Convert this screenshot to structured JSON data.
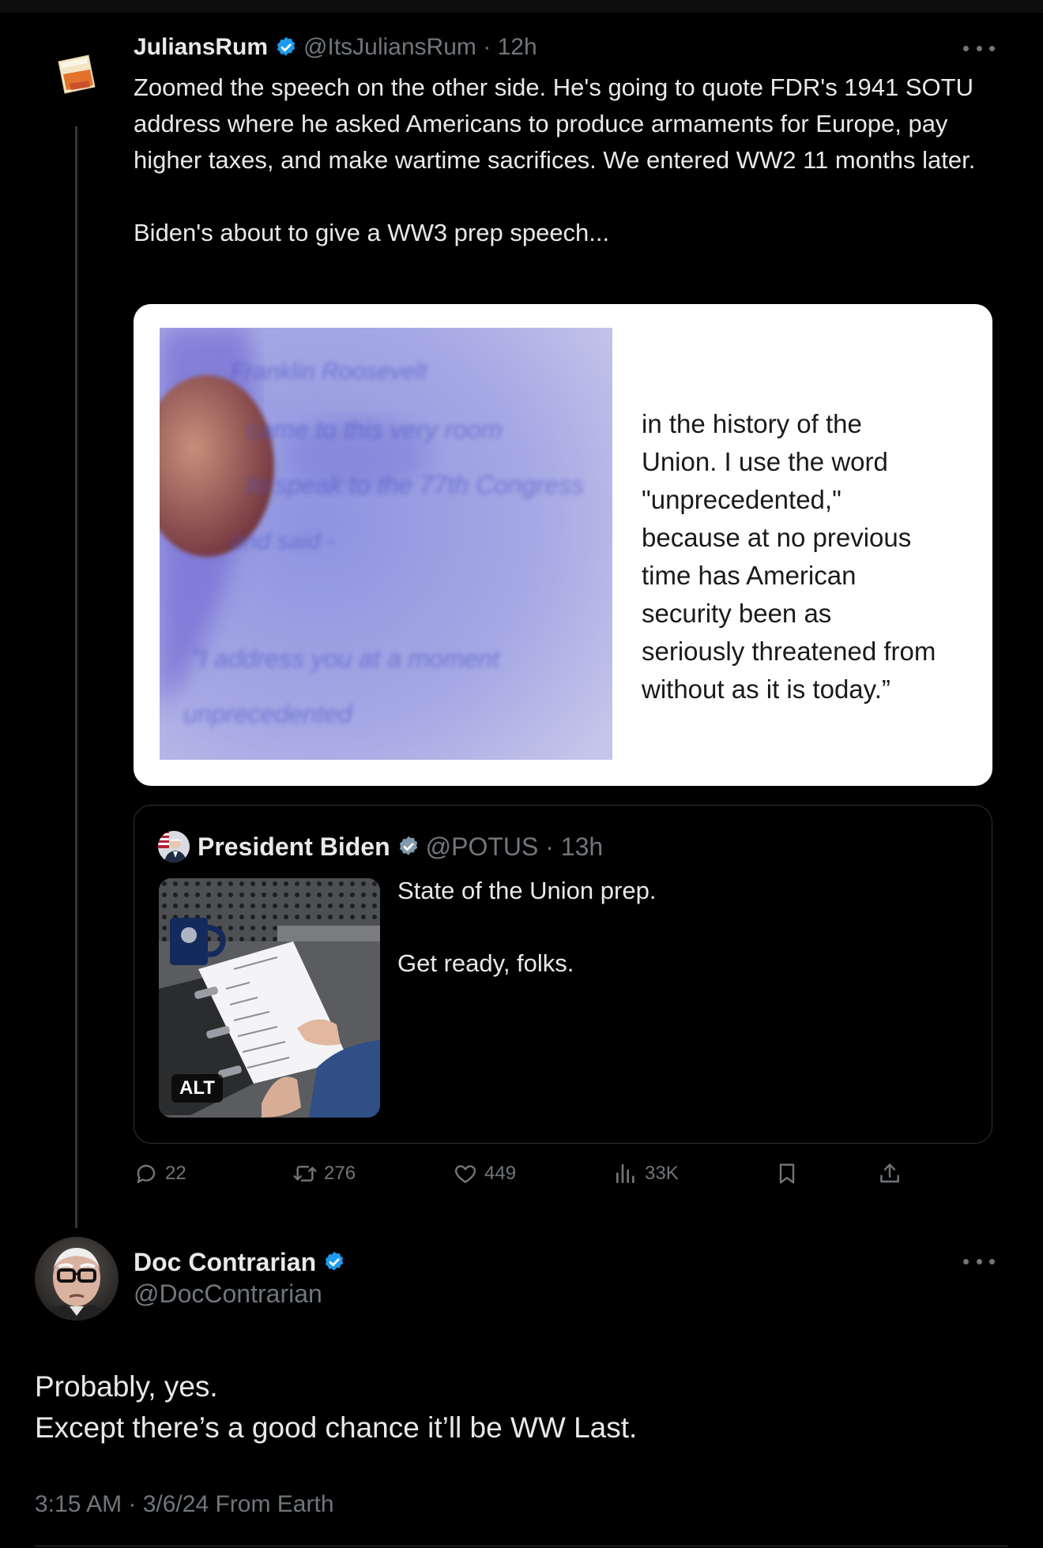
{
  "tweet": {
    "author": {
      "display_name": "JuliansRum",
      "handle": "@ItsJuliansRum",
      "time": "12h",
      "verified": true
    },
    "text": "Zoomed the speech on the other side. He's going to quote FDR's 1941 SOTU address where he asked Americans to produce armaments for Europe, pay higher taxes, and make wartime sacrifices. We entered WW2 11 months later.\n\nBiden's about to give a WW3 prep speech...",
    "media": {
      "quote_text": "in the history of the\nUnion. I use the word\n\"unprecedented,\"\nbecause at no previous\ntime has American\nsecurity been as\nseriously threatened from\nwithout as it is today.”"
    },
    "quoted": {
      "display_name": "President Biden",
      "handle": "@POTUS",
      "time": "13h",
      "text": "State of the Union prep.\n\nGet ready, folks.",
      "alt_badge": "ALT"
    },
    "stats": {
      "replies": "22",
      "reposts": "276",
      "likes": "449",
      "views": "33K"
    }
  },
  "reply": {
    "display_name": "Doc Contrarian",
    "handle": "@DocContrarian",
    "text": "Probably, yes.\nExcept there’s a good chance it’ll be WW Last.",
    "meta": "3:15 AM · 3/6/24 From Earth"
  },
  "colors": {
    "background": "#000000",
    "primary_text": "#e7e9ea",
    "secondary_text": "#71767b",
    "verified_blue": "#1d9bf0",
    "border": "#2f3336"
  },
  "icons": [
    "verified-badge-icon",
    "more-icon",
    "reply-icon",
    "repost-icon",
    "like-icon",
    "views-icon",
    "bookmark-icon",
    "share-icon"
  ]
}
